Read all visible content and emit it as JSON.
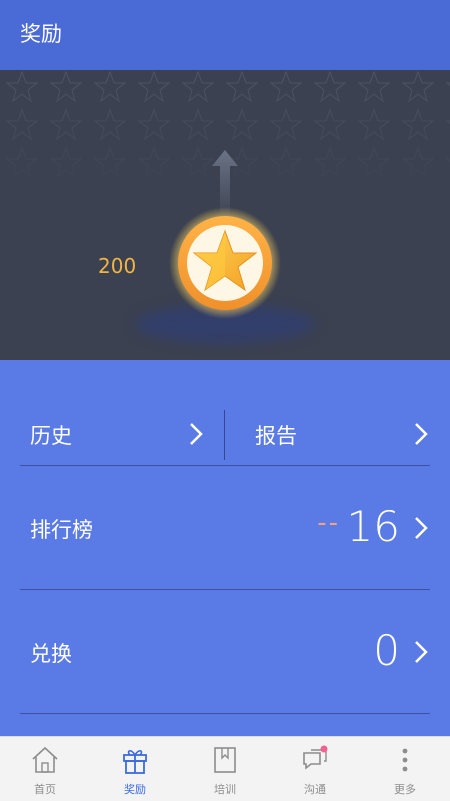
{
  "header": {
    "title": "奖励"
  },
  "hero": {
    "points": "200"
  },
  "menu": {
    "history_label": "历史",
    "report_label": "报告",
    "ranking": {
      "label": "排行榜",
      "dashes": "--",
      "value": "16"
    },
    "exchange": {
      "label": "兑换",
      "value": "0"
    }
  },
  "tabs": [
    {
      "label": "首页",
      "icon": "home-icon",
      "active": false
    },
    {
      "label": "奖励",
      "icon": "gift-icon",
      "active": true
    },
    {
      "label": "培训",
      "icon": "book-icon",
      "active": false
    },
    {
      "label": "沟通",
      "icon": "chat-icon",
      "active": false
    },
    {
      "label": "更多",
      "icon": "more-icon",
      "active": false
    }
  ],
  "colors": {
    "appbar": "#4a6ad6",
    "hero_bg": "#3b4150",
    "panel_bg": "#5a7be6",
    "gold": "#f1b542",
    "dash_orange": "#f3a37a",
    "active_tab": "#3c6be0",
    "notification_dot": "#f06292"
  }
}
